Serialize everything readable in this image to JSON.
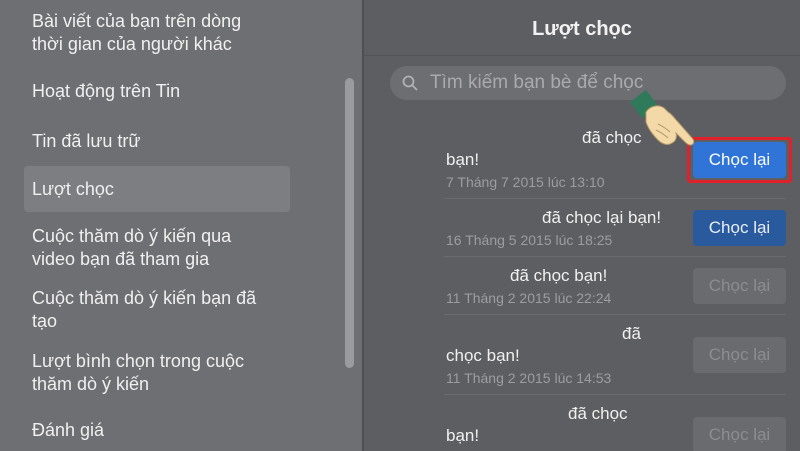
{
  "sidebar": {
    "items": [
      {
        "line1": "Bài viết của bạn trên dòng",
        "line2": "thời gian của người khác"
      },
      {
        "line1": "Hoạt động trên Tin"
      },
      {
        "line1": "Tin đã lưu trữ"
      },
      {
        "line1": "Lượt chọc"
      },
      {
        "line1": "Cuộc thăm dò ý kiến qua",
        "line2": "video bạn đã tham gia"
      },
      {
        "line1": "Cuộc thăm dò ý kiến bạn đã",
        "line2": "tạo"
      },
      {
        "line1": "Lượt bình chọn trong cuộc",
        "line2": "thăm dò ý kiến"
      },
      {
        "line1": "Đánh giá"
      }
    ],
    "active_index": 3
  },
  "main": {
    "title": "Lượt chọc",
    "search": {
      "placeholder": "Tìm kiếm bạn bè để chọc"
    },
    "pokes": [
      {
        "text1": "đã chọc",
        "text2": "bạn!",
        "time": "7 Tháng 7 2015 lúc 13:10",
        "button": "Chọc lại",
        "state": "highlight"
      },
      {
        "text1": "đã chọc lại bạn!",
        "time": "16 Tháng 5 2015 lúc 18:25",
        "button": "Chọc lại",
        "state": "primary"
      },
      {
        "text1": "đã chọc bạn!",
        "time": "11 Tháng 2 2015 lúc 22:24",
        "button": "Chọc lại",
        "state": "disabled"
      },
      {
        "text1": "đã",
        "text2": "chọc bạn!",
        "time": "11 Tháng 2 2015 lúc 14:53",
        "button": "Chọc lại",
        "state": "disabled"
      },
      {
        "text1": "đã chọc",
        "text2": "bạn!",
        "button": "Chọc lại",
        "state": "disabled"
      }
    ]
  },
  "colors": {
    "highlight_border": "#e0202a",
    "primary_button": "#2f74d6"
  },
  "icons": {
    "search": "search-icon",
    "pointer": "pointing-hand-icon"
  }
}
